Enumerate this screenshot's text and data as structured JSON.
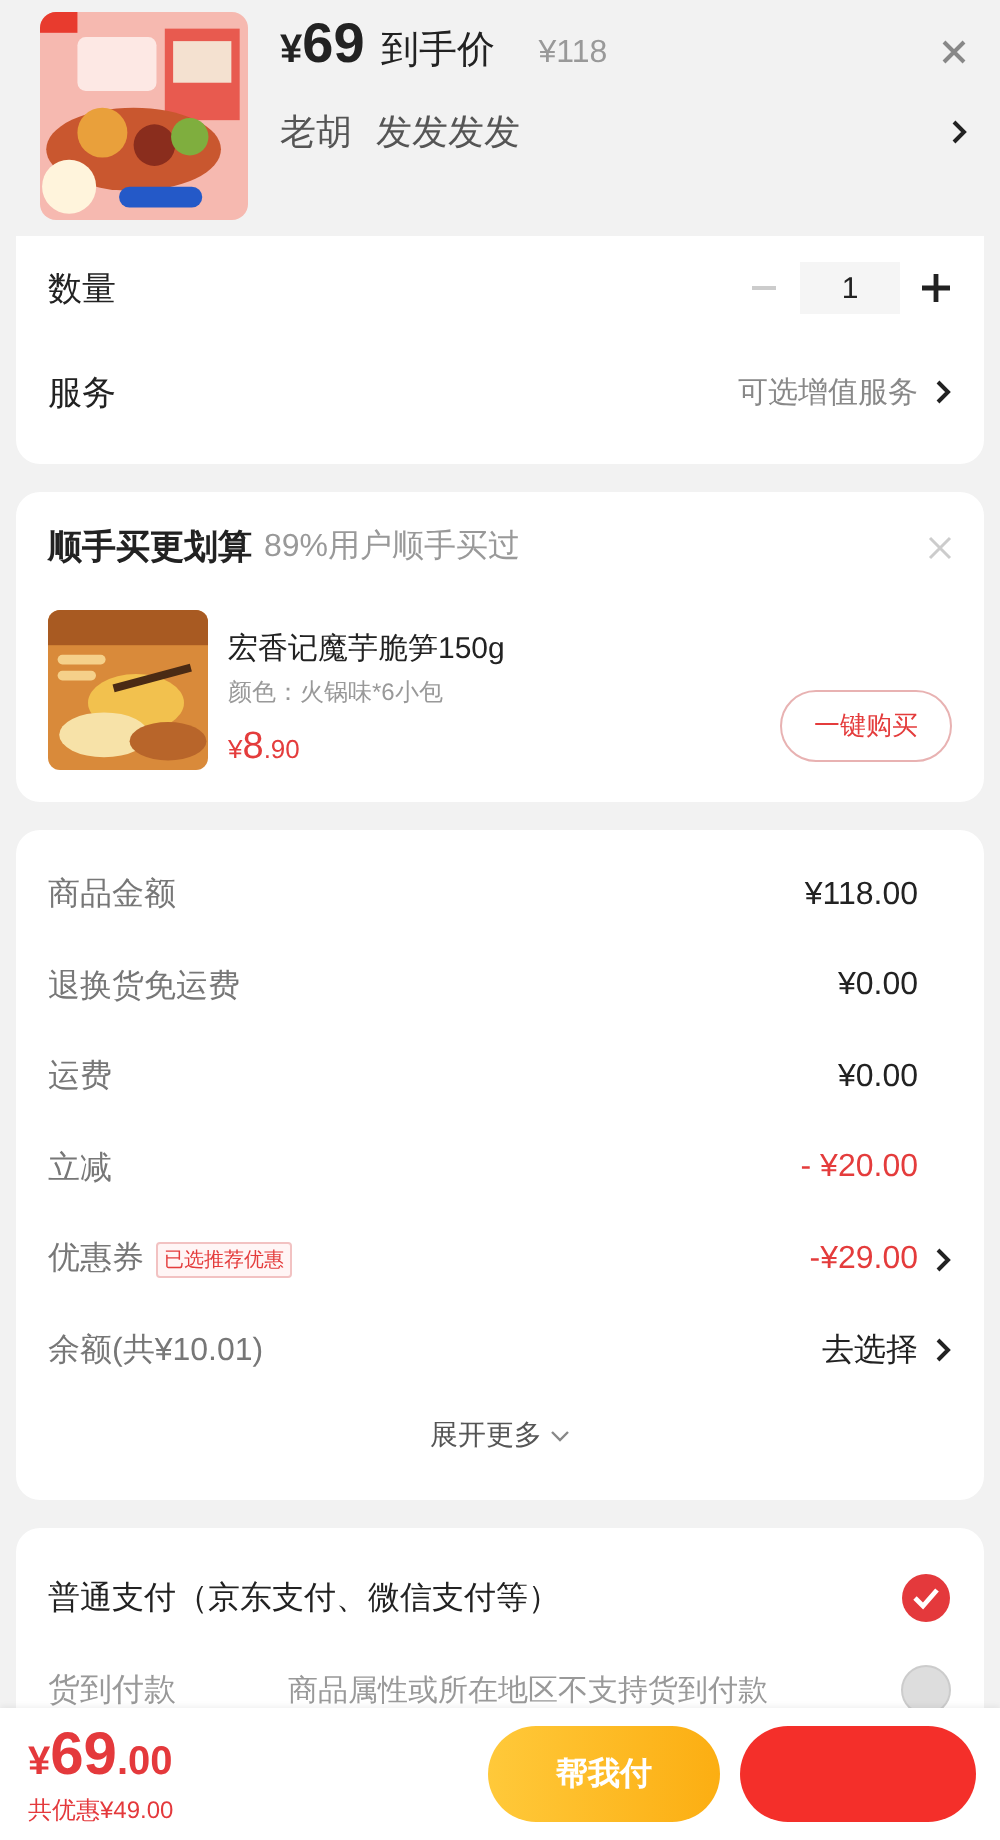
{
  "header": {
    "currency": "¥",
    "price": "69",
    "price_label": "到手价",
    "original_price": "¥118",
    "recipient": "老胡",
    "address": "发发发发"
  },
  "options": {
    "quantity": {
      "label": "数量",
      "value": "1",
      "minus_disabled": true
    },
    "service": {
      "label": "服务",
      "value": "可选增值服务"
    }
  },
  "addon": {
    "title": "顺手买更划算",
    "subtitle": "89%用户顺手买过",
    "item": {
      "name": "宏香记魔芋脆笋150g",
      "spec": "颜色：火锅味*6小包",
      "currency": "¥",
      "price_int": "8",
      "price_dec": ".90",
      "button": "一键购买"
    }
  },
  "fees": {
    "rows": [
      {
        "kind": "plain",
        "label": "商品金额",
        "value": "¥118.00"
      },
      {
        "kind": "plain",
        "label": "退换货免运费",
        "value": "¥0.00"
      },
      {
        "kind": "plain",
        "label": "运费",
        "value": "¥0.00"
      },
      {
        "kind": "discount",
        "label": "立减",
        "value": "- ¥20.00"
      },
      {
        "kind": "coupon",
        "label": "优惠券",
        "tag": "已选推荐优惠",
        "value": "-¥29.00"
      },
      {
        "kind": "select",
        "label": "余额(共¥10.01)",
        "value": "去选择"
      }
    ],
    "expand": "展开更多"
  },
  "payment": [
    {
      "label": "普通支付（京东支付、微信支付等）",
      "selected": true,
      "disabled": false
    },
    {
      "label": "货到付款",
      "note": "商品属性或所在地区不支持货到付款",
      "selected": false,
      "disabled": true
    }
  ],
  "footer": {
    "currency": "¥",
    "total_int": "69",
    "total_dec": ".00",
    "saving": "共优惠¥49.00",
    "help_button": "帮我付"
  }
}
